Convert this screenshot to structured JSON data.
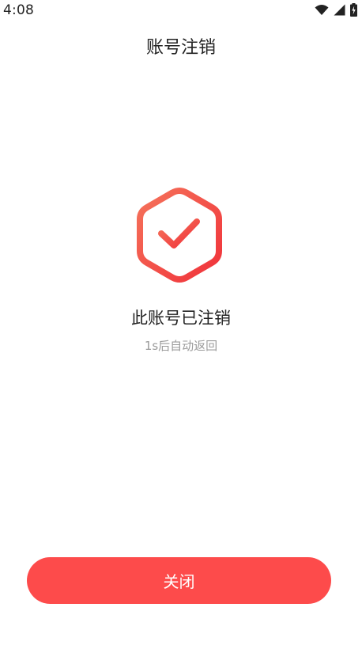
{
  "status_bar": {
    "time": "4:08",
    "icons": [
      "wifi-icon",
      "cellular-signal-icon",
      "battery-charging-icon"
    ]
  },
  "header": {
    "title": "账号注销"
  },
  "result": {
    "icon": "shield-check-icon",
    "title": "此账号已注销",
    "subtitle": "1s后自动返回"
  },
  "footer": {
    "close_label": "关闭"
  },
  "colors": {
    "accent": "#fd4b4b",
    "icon_gradient_start": "#f5715a",
    "icon_gradient_end": "#f1353b",
    "subtitle": "#9b9b9b"
  }
}
